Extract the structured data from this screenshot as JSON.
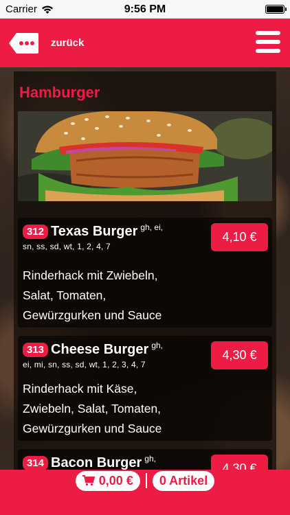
{
  "statusbar": {
    "carrier": "Carrier",
    "time": "9:56 PM"
  },
  "header": {
    "back_label": "zurück"
  },
  "category": {
    "title": "Hamburger"
  },
  "items": [
    {
      "number": "312",
      "name": "Texas Burger",
      "sup": "gh, ei,",
      "allergens": "sn, ss, sd, wt, 1, 2, 4, 7",
      "price": "4,10 €",
      "desc": [
        "Rinderhack mit Zwiebeln,",
        "Salat, Tomaten,",
        "Gewürzgurken und Sauce"
      ]
    },
    {
      "number": "313",
      "name": "Cheese Burger",
      "sup": "gh,",
      "allergens": "ei, mi, sn, ss, sd, wt, 1, 2, 3, 4, 7",
      "price": "4,30 €",
      "desc": [
        "Rinderhack mit Käse,",
        "Zwiebeln, Salat, Tomaten,",
        "Gewürzgurken und Sauce"
      ]
    },
    {
      "number": "314",
      "name": "Bacon Burger",
      "sup": "gh,",
      "price": "4,30 €"
    }
  ],
  "footer": {
    "total": "0,00 €",
    "count": "0 Artikel"
  },
  "colors": {
    "accent": "#ed1c45",
    "statusbar": "#f7f7f7"
  }
}
